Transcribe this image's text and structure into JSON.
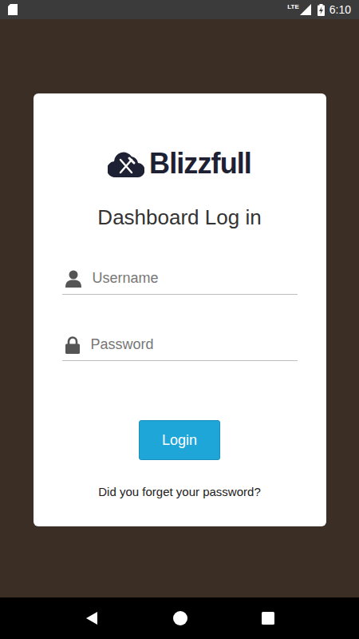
{
  "status_bar": {
    "network": "LTE",
    "time": "6:10",
    "battery": {
      "charging": true
    }
  },
  "logo": {
    "text": "Blizzfull"
  },
  "title": "Dashboard Log in",
  "fields": [
    {
      "kind": "username",
      "placeholder": "Username"
    },
    {
      "kind": "password",
      "placeholder": "Password"
    }
  ],
  "button": "Login",
  "link": "Did you forget your password?"
}
